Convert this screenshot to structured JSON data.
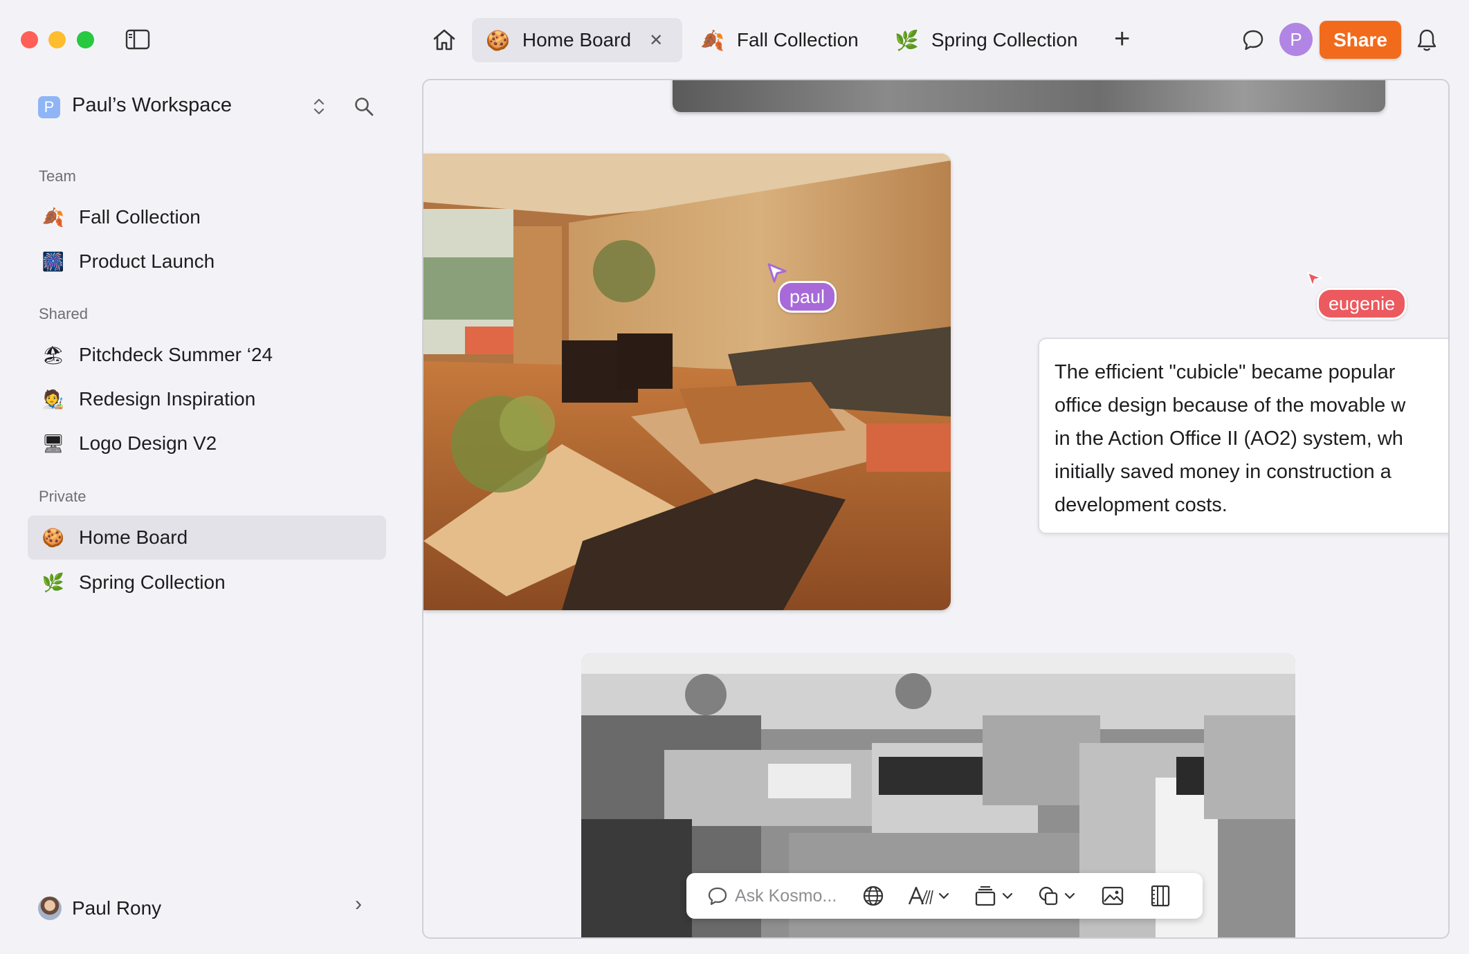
{
  "window": {
    "tabs": [
      {
        "label": "Home Board",
        "emoji": "🍪",
        "active": true
      },
      {
        "label": "Fall Collection",
        "emoji": "🍂",
        "active": false
      },
      {
        "label": "Spring Collection",
        "emoji": "🌿",
        "active": false
      }
    ],
    "avatar_initial": "P",
    "share_label": "Share",
    "close_glyph": "✕",
    "add_glyph": "+"
  },
  "sidebar": {
    "workspace": {
      "badge": "P",
      "name": "Paul’s Workspace"
    },
    "sections": [
      {
        "label": "Team",
        "items": [
          {
            "label": "Fall Collection",
            "emoji": "🍂"
          },
          {
            "label": "Product Launch",
            "emoji": "🎆"
          }
        ]
      },
      {
        "label": "Shared",
        "items": [
          {
            "label": "Pitchdeck Summer ‘24",
            "emoji": "🏖"
          },
          {
            "label": "Redesign Inspiration",
            "emoji": "🧑‍🎨"
          },
          {
            "label": "Logo Design V2",
            "emoji": "🖥"
          }
        ]
      },
      {
        "label": "Private",
        "items": [
          {
            "label": "Home Board",
            "emoji": "🍪",
            "active": true
          },
          {
            "label": "Spring Collection",
            "emoji": "🌿"
          }
        ]
      }
    ],
    "user": {
      "name": "Paul Rony",
      "chevron": "›"
    }
  },
  "canvas": {
    "note_lines": [
      "The efficient \"cubicle\" became popular",
      "office design because of the movable w",
      "in the Action Office II (AO2) system, wh",
      "initially saved money in construction a",
      "development costs."
    ],
    "cursors": [
      {
        "name": "paul",
        "color": "#a86ad8"
      },
      {
        "name": "eugenie",
        "color": "#ec5a5f"
      }
    ],
    "toolbar": {
      "placeholder": "Ask Kosmo..."
    }
  },
  "icons": {
    "sidebar_toggle": "sidebar-toggle-icon",
    "home": "home-icon",
    "chat": "chat-bubble-icon",
    "bell": "bell-icon",
    "search": "search-icon",
    "updown": "chevron-updown-icon"
  }
}
